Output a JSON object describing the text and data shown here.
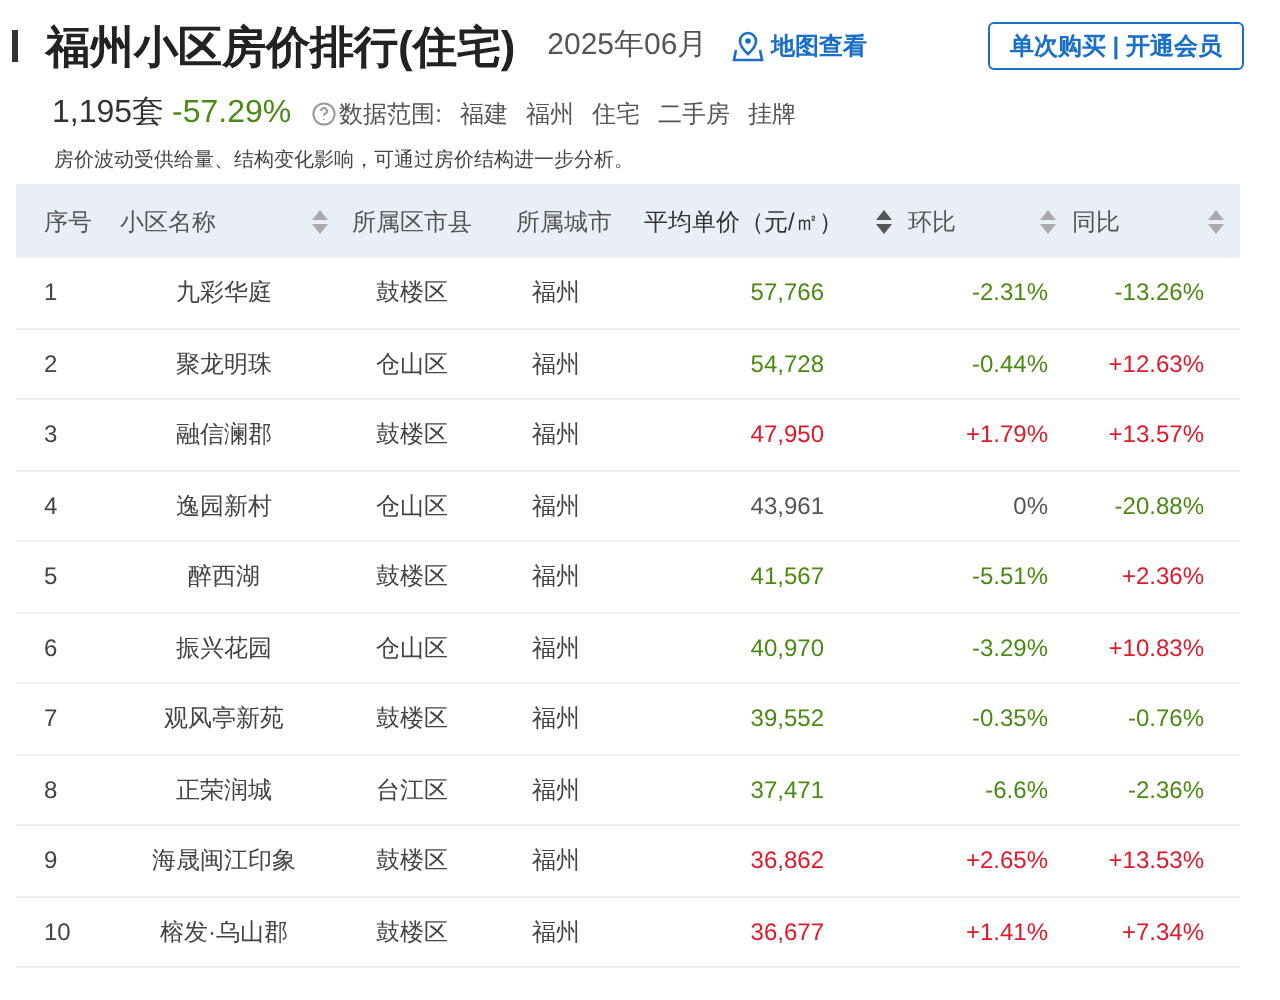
{
  "header": {
    "title": "福州小区房价排行(住宅)",
    "period": "2025年06月",
    "map_link": "地图查看",
    "member_button": "单次购买 | 开通会员"
  },
  "summary": {
    "count": "1,195套",
    "change": {
      "text": "-57.29%",
      "color": "#4a8a12"
    },
    "scope_label": "数据范围:",
    "scope_tags": [
      "福建",
      "福州",
      "住宅",
      "二手房",
      "挂牌"
    ]
  },
  "note": "房价波动受供给量、结构变化影响，可通过房价结构进一步分析。",
  "table": {
    "columns": [
      {
        "label": "序号",
        "sortable": false,
        "selected": false
      },
      {
        "label": "小区名称",
        "sortable": true,
        "selected": false
      },
      {
        "label": "所属区市县",
        "sortable": false,
        "selected": false
      },
      {
        "label": "所属城市",
        "sortable": false,
        "selected": false
      },
      {
        "label": "平均单价（元/㎡）",
        "sortable": true,
        "selected": true
      },
      {
        "label": "环比",
        "sortable": true,
        "selected": false
      },
      {
        "label": "同比",
        "sortable": true,
        "selected": false
      }
    ],
    "rows": [
      {
        "rank": "1",
        "name": "九彩华庭",
        "district": "鼓楼区",
        "city": "福州",
        "price": {
          "text": "57,766",
          "color": "#4a8a12"
        },
        "mom": {
          "text": "-2.31%",
          "color": "#4a8a12"
        },
        "yoy": {
          "text": "-13.26%",
          "color": "#4a8a12"
        }
      },
      {
        "rank": "2",
        "name": "聚龙明珠",
        "district": "仓山区",
        "city": "福州",
        "price": {
          "text": "54,728",
          "color": "#4a8a12"
        },
        "mom": {
          "text": "-0.44%",
          "color": "#4a8a12"
        },
        "yoy": {
          "text": "+12.63%",
          "color": "#e0182a"
        }
      },
      {
        "rank": "3",
        "name": "融信澜郡",
        "district": "鼓楼区",
        "city": "福州",
        "price": {
          "text": "47,950",
          "color": "#e0182a"
        },
        "mom": {
          "text": "+1.79%",
          "color": "#e0182a"
        },
        "yoy": {
          "text": "+13.57%",
          "color": "#e0182a"
        }
      },
      {
        "rank": "4",
        "name": "逸园新村",
        "district": "仓山区",
        "city": "福州",
        "price": {
          "text": "43,961",
          "color": "#555555"
        },
        "mom": {
          "text": "0%",
          "color": "#555555"
        },
        "yoy": {
          "text": "-20.88%",
          "color": "#4a8a12"
        }
      },
      {
        "rank": "5",
        "name": "醉西湖",
        "district": "鼓楼区",
        "city": "福州",
        "price": {
          "text": "41,567",
          "color": "#4a8a12"
        },
        "mom": {
          "text": "-5.51%",
          "color": "#4a8a12"
        },
        "yoy": {
          "text": "+2.36%",
          "color": "#e0182a"
        }
      },
      {
        "rank": "6",
        "name": "振兴花园",
        "district": "仓山区",
        "city": "福州",
        "price": {
          "text": "40,970",
          "color": "#4a8a12"
        },
        "mom": {
          "text": "-3.29%",
          "color": "#4a8a12"
        },
        "yoy": {
          "text": "+10.83%",
          "color": "#e0182a"
        }
      },
      {
        "rank": "7",
        "name": "观风亭新苑",
        "district": "鼓楼区",
        "city": "福州",
        "price": {
          "text": "39,552",
          "color": "#4a8a12"
        },
        "mom": {
          "text": "-0.35%",
          "color": "#4a8a12"
        },
        "yoy": {
          "text": "-0.76%",
          "color": "#4a8a12"
        }
      },
      {
        "rank": "8",
        "name": "正荣润城",
        "district": "台江区",
        "city": "福州",
        "price": {
          "text": "37,471",
          "color": "#4a8a12"
        },
        "mom": {
          "text": "-6.6%",
          "color": "#4a8a12"
        },
        "yoy": {
          "text": "-2.36%",
          "color": "#4a8a12"
        }
      },
      {
        "rank": "9",
        "name": "海晟闽江印象",
        "district": "鼓楼区",
        "city": "福州",
        "price": {
          "text": "36,862",
          "color": "#e0182a"
        },
        "mom": {
          "text": "+2.65%",
          "color": "#e0182a"
        },
        "yoy": {
          "text": "+13.53%",
          "color": "#e0182a"
        }
      },
      {
        "rank": "10",
        "name": "榕发·乌山郡",
        "district": "鼓楼区",
        "city": "福州",
        "price": {
          "text": "36,677",
          "color": "#e0182a"
        },
        "mom": {
          "text": "+1.41%",
          "color": "#e0182a"
        },
        "yoy": {
          "text": "+7.34%",
          "color": "#e0182a"
        }
      }
    ]
  }
}
